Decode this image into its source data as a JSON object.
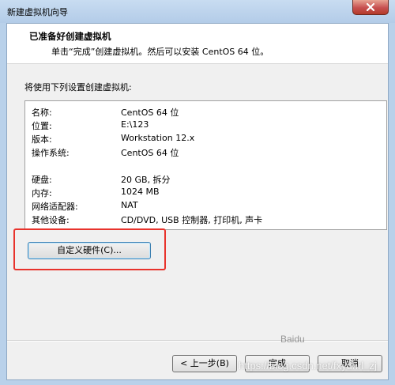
{
  "window": {
    "title": "新建虚拟机向导"
  },
  "header": {
    "title": "已准备好创建虚拟机",
    "description": "单击“完成”创建虚拟机。然后可以安装 CentOS 64 位。"
  },
  "intro_label": "将使用下列设置创建虚拟机:",
  "settings": [
    {
      "key": "名称:",
      "value": "CentOS 64 位"
    },
    {
      "key": "位置:",
      "value": "E:\\123"
    },
    {
      "key": "版本:",
      "value": "Workstation 12.x"
    },
    {
      "key": "操作系统:",
      "value": "CentOS 64 位"
    },
    {
      "key": "硬盘:",
      "value": "20 GB, 拆分"
    },
    {
      "key": "内存:",
      "value": "1024 MB"
    },
    {
      "key": "网络适配器:",
      "value": "NAT"
    },
    {
      "key": "其他设备:",
      "value": "CD/DVD, USB 控制器, 打印机, 声卡"
    }
  ],
  "buttons": {
    "customize_hardware": "自定义硬件(C)...",
    "back": "< 上一步(B)",
    "finish": "完成",
    "cancel": "取消"
  },
  "watermark": {
    "logo": "Baidu",
    "url": "https://blog.csdn.net/fxydhrl_zj"
  },
  "colors": {
    "highlight": "#e8332c",
    "close_button": "#c75050"
  }
}
